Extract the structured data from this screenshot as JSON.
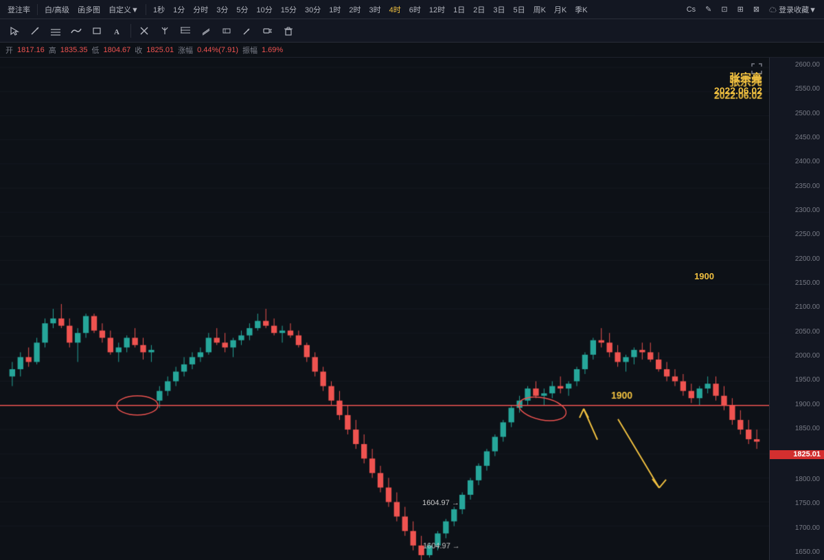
{
  "toolbar": {
    "left_items": [
      "登注率",
      "白/高级",
      "函多图",
      "自定义▼",
      "1秒",
      "1分",
      "分时",
      "3分",
      "5分",
      "10分",
      "15分",
      "30分",
      "1时",
      "2时",
      "3时",
      "4时",
      "6时",
      "12时",
      "1日",
      "2日",
      "3日",
      "5日",
      "周K",
      "月K",
      "季K"
    ],
    "active_item": "4时",
    "right_items": [
      "Cs",
      "✎",
      "⊡",
      "⊞",
      "⊠"
    ]
  },
  "drawing_tools": [
    "↗",
    "≡",
    "∿",
    "▭",
    "A",
    "✕",
    "⟨⟩",
    "⟨",
    "⟩",
    "⊘",
    "▯",
    "▭",
    "▭⬒",
    "🗑"
  ],
  "ohlc": {
    "open_label": "开",
    "open_value": "1817.16",
    "high_label": "高",
    "high_value": "1835.35",
    "low_label": "低",
    "low_value": "1804.67",
    "close_label": "收",
    "close_value": "1825.01",
    "change_label": "涨幅",
    "change_value": "0.44%(7.91)",
    "amplitude_label": "振幅",
    "amplitude_value": "1.69%"
  },
  "price_axis": {
    "prices": [
      "2600.00",
      "2550.00",
      "2500.00",
      "2450.00",
      "2400.00",
      "2350.00",
      "2300.00",
      "2250.00",
      "2200.00",
      "2150.00",
      "2100.00",
      "2050.00",
      "2000.00",
      "1950.00",
      "1900.00",
      "1850.00",
      "1800.00",
      "1750.00",
      "1700.00",
      "1650.00"
    ],
    "current_price": "1825.01"
  },
  "annotations": {
    "watermark_name": "张宗亮",
    "watermark_date": "2022.06.02",
    "level_1900": "1900",
    "level_1604": "1604.97 →",
    "horizontal_line_price": 1900
  },
  "colors": {
    "background": "#0d1117",
    "toolbar_bg": "#131722",
    "up_candle": "#26a69a",
    "down_candle": "#ef5350",
    "horizontal_line": "#ef5350",
    "annotation_color": "#f0c040",
    "current_price_bg": "#d32f2f",
    "price_axis_bg": "#131722"
  }
}
